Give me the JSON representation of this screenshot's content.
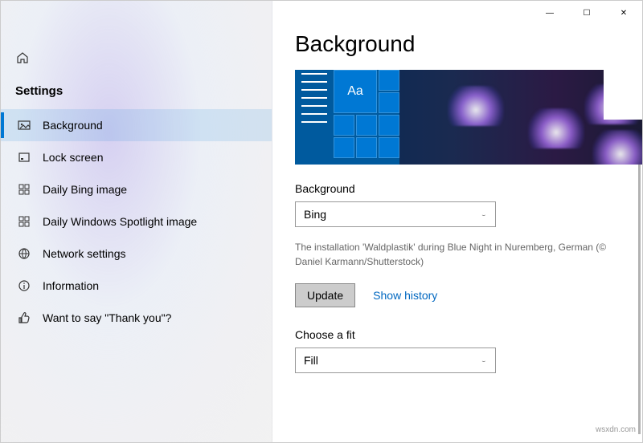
{
  "window": {
    "minimize": "—",
    "maximize": "☐",
    "close": "✕"
  },
  "sidebar": {
    "title": "Settings",
    "items": [
      {
        "label": "Background",
        "icon": "picture-icon",
        "selected": true
      },
      {
        "label": "Lock screen",
        "icon": "lockscreen-icon",
        "selected": false
      },
      {
        "label": "Daily Bing image",
        "icon": "grid-icon",
        "selected": false
      },
      {
        "label": "Daily Windows Spotlight image",
        "icon": "grid-icon",
        "selected": false
      },
      {
        "label": "Network settings",
        "icon": "globe-icon",
        "selected": false
      },
      {
        "label": "Information",
        "icon": "info-icon",
        "selected": false
      },
      {
        "label": "Want to say \"Thank you\"?",
        "icon": "thumbsup-icon",
        "selected": false
      }
    ]
  },
  "main": {
    "page_title": "Background",
    "preview_sample": "Aa",
    "background_label": "Background",
    "background_value": "Bing",
    "image_caption": "The installation 'Waldplastik' during Blue Night in Nuremberg, German (© Daniel Karmann/Shutterstock)",
    "update_btn": "Update",
    "history_link": "Show history",
    "fit_label": "Choose a fit",
    "fit_value": "Fill"
  },
  "watermark": "wsxdn.com"
}
